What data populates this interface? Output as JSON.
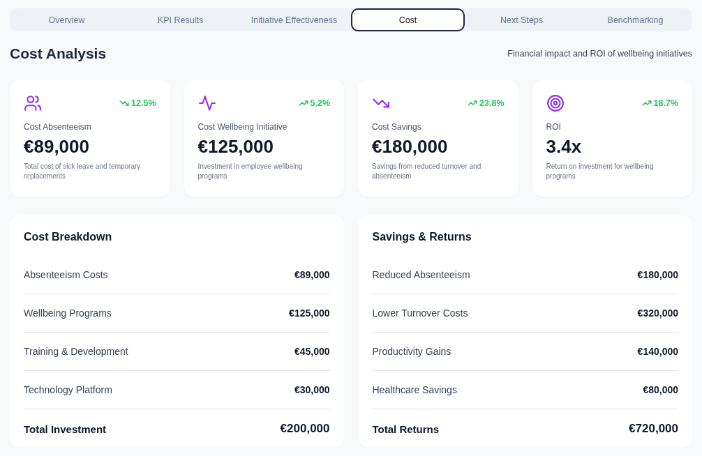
{
  "tabs": [
    {
      "label": "Overview",
      "selected": false
    },
    {
      "label": "KPI Results",
      "selected": false
    },
    {
      "label": "Initiative Effectiveness",
      "selected": false
    },
    {
      "label": "Cost",
      "selected": true
    },
    {
      "label": "Next Steps",
      "selected": false
    },
    {
      "label": "Benchmarking",
      "selected": false
    }
  ],
  "header": {
    "title": "Cost Analysis",
    "subtitle": "Financial impact and ROI of wellbeing initiatives"
  },
  "metrics": [
    {
      "rising": false,
      "change": "12.5%",
      "label": "Cost Absenteeism",
      "value": "€89,000",
      "description": "Total cost of sick leave and temporary replacements"
    },
    {
      "rising": true,
      "change": "5.2%",
      "label": "Cost Wellbeing Initiative",
      "value": "€125,000",
      "description": "Investment in employee wellbeing programs"
    },
    {
      "rising": true,
      "change": "23.8%",
      "label": "Cost Savings",
      "value": "€180,000",
      "description": "Savings from reduced turnover and absenteeism"
    },
    {
      "rising": true,
      "change": "18.7%",
      "label": "ROI",
      "value": "3.4x",
      "description": "Return on investment for wellbeing programs"
    }
  ],
  "panels": [
    {
      "title": "Cost Breakdown",
      "rows": [
        {
          "label": "Absenteeism Costs",
          "amount": "€89,000"
        },
        {
          "label": "Wellbeing Programs",
          "amount": "€125,000"
        },
        {
          "label": "Training & Development",
          "amount": "€45,000"
        },
        {
          "label": "Technology Platform",
          "amount": "€30,000"
        }
      ],
      "total": {
        "label": "Total Investment",
        "amount": "€200,000"
      }
    },
    {
      "title": "Savings & Returns",
      "rows": [
        {
          "label": "Reduced Absenteeism",
          "amount": "€180,000"
        },
        {
          "label": "Lower Turnover Costs",
          "amount": "€320,000"
        },
        {
          "label": "Productivity Gains",
          "amount": "€140,000"
        },
        {
          "label": "Healthcare Savings",
          "amount": "€80,000"
        }
      ],
      "total": {
        "label": "Total Returns",
        "amount": "€720,000"
      }
    }
  ]
}
